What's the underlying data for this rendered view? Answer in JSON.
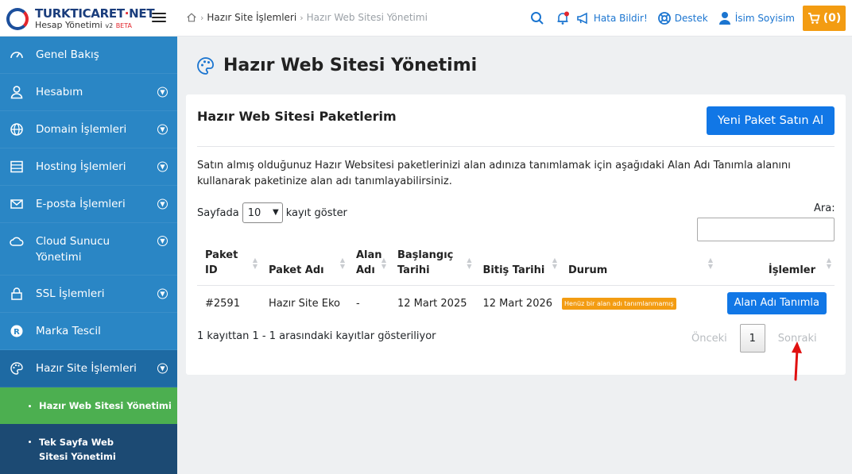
{
  "header": {
    "brand_main": "TURKTICARET",
    "brand_net": "NET",
    "brand_dot": "·",
    "brand_sub": "Hesap Yönetimi",
    "brand_ver": "v2",
    "brand_beta": "BETA",
    "breadcrumb": [
      "Hazır Site İşlemleri",
      "Hazır Web Sitesi Yönetimi"
    ],
    "report_label": "Hata Bildir!",
    "support_label": "Destek",
    "user_label": "İsim Soyisim",
    "cart_count": "(0)",
    "accent": "#1b75d0",
    "cart_color": "#f39c12"
  },
  "sidebar": {
    "bg": "#2a86c5",
    "items": [
      {
        "label": "Genel Bakış",
        "icon": "gauge-icon"
      },
      {
        "label": "Hesabım",
        "icon": "user-icon"
      },
      {
        "label": "Domain İşlemleri",
        "icon": "globe-icon"
      },
      {
        "label": "Hosting İşlemleri",
        "icon": "server-icon"
      },
      {
        "label": "E-posta İşlemleri",
        "icon": "envelope-icon"
      },
      {
        "label": "Cloud Sunucu Yönetimi",
        "icon": "cloud-icon"
      },
      {
        "label": "SSL İşlemleri",
        "icon": "lock-icon"
      },
      {
        "label": "Marka Tescil",
        "icon": "registered-icon"
      },
      {
        "label": "Hazır Site İşlemleri",
        "icon": "palette-icon"
      }
    ],
    "sub_items": [
      {
        "label": "Hazır Web Sitesi Yönetimi",
        "active": true
      },
      {
        "label": "Tek Sayfa Web Sitesi Yönetimi",
        "active": false
      }
    ]
  },
  "main": {
    "page_title": "Hazır Web Sitesi Yönetimi",
    "card_title": "Hazır Web Sitesi Paketlerim",
    "buy_button": "Yeni Paket Satın Al",
    "description": "Satın almış olduğunuz Hazır Websitesi paketlerinizi alan adınıza tanımlamak için aşağıdaki Alan Adı Tanımla alanını kullanarak paketinize alan adı tanımlayabilirsiniz.",
    "length_prefix": "Sayfada",
    "length_value": "10",
    "length_suffix": "kayıt göster",
    "search_label": "Ara:",
    "columns": [
      "Paket ID",
      "Paket Adı",
      "Alan Adı",
      "Başlangıç Tarihi",
      "Bitiş Tarihi",
      "Durum",
      "İşlemler"
    ],
    "rows": [
      {
        "id": "#2591",
        "name": "Hazır Site Eko",
        "domain": "-",
        "start": "12 Mart 2025",
        "end": "12 Mart 2026",
        "status": "Henüz bir alan adı tanımlanmamış",
        "action": "Alan Adı Tanımla"
      }
    ],
    "info_text": "1 kayıttan 1 - 1 arasındaki kayıtlar gösteriliyor",
    "pager_prev": "Önceki",
    "pager_page": "1",
    "pager_next": "Sonraki"
  }
}
